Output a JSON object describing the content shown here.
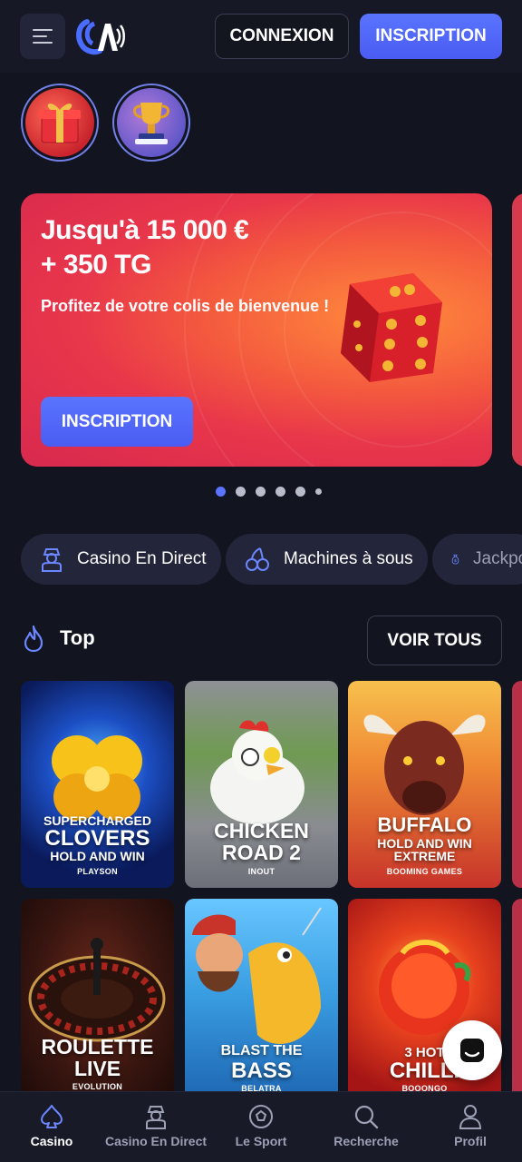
{
  "header": {
    "login_label": "CONNEXION",
    "signup_label": "INSCRIPTION"
  },
  "banner": {
    "title_line1": "Jusqu'à 15 000 €",
    "title_line2": "+ 350 TG",
    "subtitle": "Profitez de votre colis de bienvenue !",
    "cta_label": "INSCRIPTION",
    "slide_count": 6,
    "active_slide": 1
  },
  "categories": [
    {
      "label": "Casino En Direct",
      "icon": "dealer-icon"
    },
    {
      "label": "Machines à sous",
      "icon": "cherry-icon"
    },
    {
      "label": "Jackpots",
      "icon": "money-bag-icon"
    }
  ],
  "top_section": {
    "title": "Top",
    "see_all_label": "VOIR TOUS"
  },
  "games": [
    {
      "line1": "SUPERCHARGED",
      "line2": "CLOVERS",
      "line3": "HOLD AND WIN",
      "provider": "PLAYSON"
    },
    {
      "line1": "CHICKEN",
      "line2": "ROAD 2",
      "provider": "INOUT"
    },
    {
      "line1": "BUFFALO",
      "line2": "HOLD AND WIN",
      "line3": "EXTREME",
      "provider": "BOOMING GAMES"
    },
    {
      "line1": "ROULETTE",
      "line2": "LIVE",
      "provider": "EVOLUTION"
    },
    {
      "line1": "BLAST THE",
      "line2": "BASS",
      "provider": "BELATRA"
    },
    {
      "line1": "3 HOT",
      "line2": "CHILLI",
      "provider": "BOOONGO"
    }
  ],
  "bottom_nav": [
    {
      "label": "Casino",
      "icon": "spade-icon",
      "active": true
    },
    {
      "label": "Casino En Direct",
      "icon": "dealer-icon"
    },
    {
      "label": "Le Sport",
      "icon": "soccer-ball-icon"
    },
    {
      "label": "Recherche",
      "icon": "search-icon"
    },
    {
      "label": "Profil",
      "icon": "user-icon"
    }
  ],
  "colors": {
    "background": "#12141f",
    "accent": "#5a74ff",
    "chip": "#23263a"
  }
}
